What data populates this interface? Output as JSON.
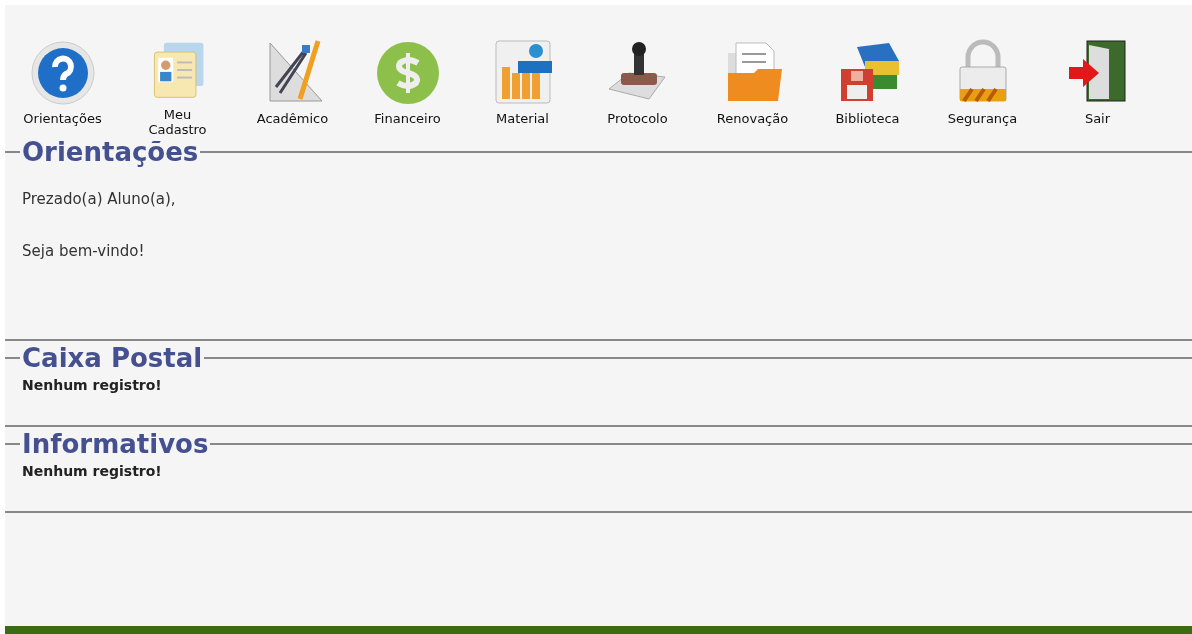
{
  "toolbar": [
    {
      "label": "Orientações"
    },
    {
      "label": "Meu\nCadastro"
    },
    {
      "label": "Acadêmico"
    },
    {
      "label": "Financeiro"
    },
    {
      "label": "Material"
    },
    {
      "label": "Protocolo"
    },
    {
      "label": "Renovação"
    },
    {
      "label": "Biblioteca"
    },
    {
      "label": "Segurança"
    },
    {
      "label": "Sair"
    }
  ],
  "sections": [
    {
      "title": "Orientações",
      "paragraphs": [
        "Prezado(a) Aluno(a),",
        "Seja bem-vindo!"
      ]
    },
    {
      "title": "Caixa Postal",
      "message": "Nenhum registro!"
    },
    {
      "title": "Informativos",
      "message": "Nenhum registro!"
    }
  ]
}
